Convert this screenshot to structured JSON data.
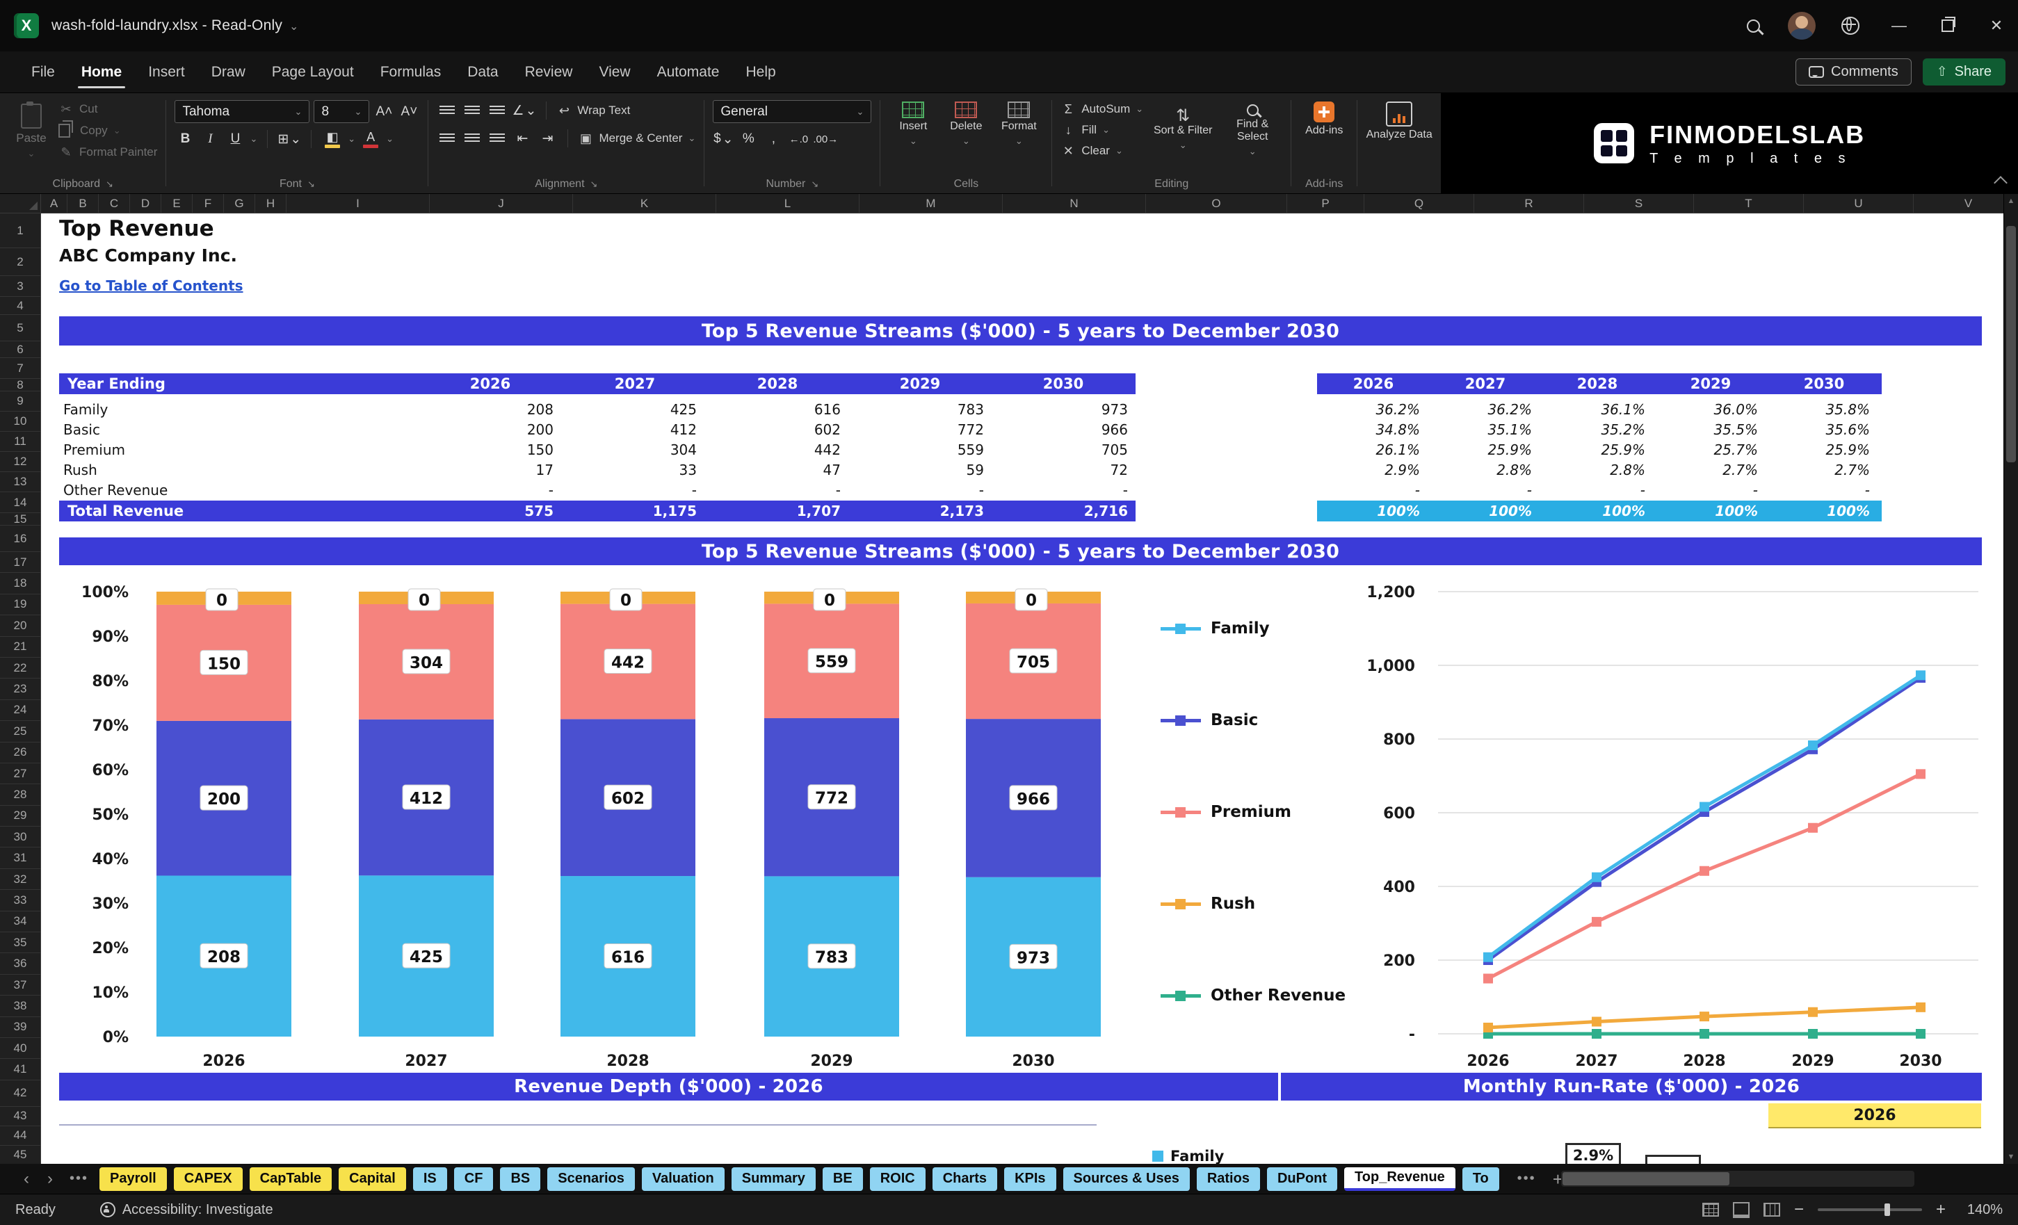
{
  "window": {
    "title": "wash-fold-laundry.xlsx  -  Read-Only"
  },
  "menu": {
    "items": [
      "File",
      "Home",
      "Insert",
      "Draw",
      "Page Layout",
      "Formulas",
      "Data",
      "Review",
      "View",
      "Automate",
      "Help"
    ],
    "active": "Home",
    "comments_label": "Comments",
    "share_label": "Share"
  },
  "ribbon": {
    "clipboard": {
      "label": "Clipboard",
      "paste": "Paste",
      "cut": "Cut",
      "copy": "Copy",
      "format_painter": "Format Painter"
    },
    "font": {
      "label": "Font",
      "name": "Tahoma",
      "size": "8"
    },
    "alignment": {
      "label": "Alignment",
      "wrap": "Wrap Text",
      "merge": "Merge & Center"
    },
    "number": {
      "label": "Number",
      "format": "General"
    },
    "cells": {
      "label": "Cells",
      "insert": "Insert",
      "delete": "Delete",
      "format": "Format"
    },
    "editing": {
      "label": "Editing",
      "autosum": "AutoSum",
      "fill": "Fill",
      "clear": "Clear",
      "sort_filter": "Sort & Filter",
      "find_select": "Find & Select"
    },
    "addins": {
      "label": "Add-ins",
      "button": "Add-ins",
      "analyze": "Analyze Data"
    },
    "brand": {
      "line1": "FINMODELSLAB",
      "line2": "T e m p l a t e s"
    }
  },
  "grid": {
    "columns": [
      "A",
      "B",
      "C",
      "D",
      "E",
      "F",
      "G",
      "H",
      "I",
      "J",
      "K",
      "L",
      "M",
      "N",
      "O",
      "P",
      "Q",
      "R",
      "S",
      "T",
      "U",
      "V"
    ],
    "rows_start": 1,
    "rows_end": 45
  },
  "sheet": {
    "title": "Top Revenue",
    "company": "ABC Company Inc.",
    "toc": "Go to Table of Contents",
    "banner1": "Top 5 Revenue Streams ($'000) - 5 years to December 2030",
    "banner2": "Top 5 Revenue Streams ($'000) - 5 years to December 2030",
    "banner3": "Revenue Depth ($'000) - 2026",
    "banner4": "Monthly Run-Rate ($'000) - 2026",
    "year_cell": "2026",
    "runrate_value": "2.9%",
    "bottom_legend": "Family"
  },
  "table": {
    "header": "Year Ending",
    "years": [
      "2026",
      "2027",
      "2028",
      "2029",
      "2030"
    ],
    "rows": [
      {
        "label": "Family",
        "values": [
          "208",
          "425",
          "616",
          "783",
          "973"
        ],
        "pcts": [
          "36.2%",
          "36.2%",
          "36.1%",
          "36.0%",
          "35.8%"
        ]
      },
      {
        "label": "Basic",
        "values": [
          "200",
          "412",
          "602",
          "772",
          "966"
        ],
        "pcts": [
          "34.8%",
          "35.1%",
          "35.2%",
          "35.5%",
          "35.6%"
        ]
      },
      {
        "label": "Premium",
        "values": [
          "150",
          "304",
          "442",
          "559",
          "705"
        ],
        "pcts": [
          "26.1%",
          "25.9%",
          "25.9%",
          "25.7%",
          "25.9%"
        ]
      },
      {
        "label": "Rush",
        "values": [
          "17",
          "33",
          "47",
          "59",
          "72"
        ],
        "pcts": [
          "2.9%",
          "2.8%",
          "2.8%",
          "2.7%",
          "2.7%"
        ]
      },
      {
        "label": "Other Revenue",
        "values": [
          "-",
          "-",
          "-",
          "-",
          "-"
        ],
        "pcts": [
          "-",
          "-",
          "-",
          "-",
          "-"
        ]
      }
    ],
    "total": {
      "label": "Total Revenue",
      "values": [
        "575",
        "1,175",
        "1,707",
        "2,173",
        "2,716"
      ],
      "pcts": [
        "100%",
        "100%",
        "100%",
        "100%",
        "100%"
      ]
    }
  },
  "chart_data": [
    {
      "type": "bar",
      "subtype": "stacked-100",
      "title": "Top 5 Revenue Streams ($'000) - 5 years to December 2030",
      "categories": [
        "2026",
        "2027",
        "2028",
        "2029",
        "2030"
      ],
      "series": [
        {
          "name": "Family",
          "color": "#41B9EA",
          "values": [
            208,
            425,
            616,
            783,
            973
          ]
        },
        {
          "name": "Basic",
          "color": "#4A50D0",
          "values": [
            200,
            412,
            602,
            772,
            966
          ]
        },
        {
          "name": "Premium",
          "color": "#F5837E",
          "values": [
            150,
            304,
            442,
            559,
            705
          ]
        },
        {
          "name": "Rush",
          "color": "#F2A93C",
          "values": [
            17,
            33,
            47,
            59,
            72
          ]
        },
        {
          "name": "Other Revenue",
          "color": "#2FAF8C",
          "values": [
            0,
            0,
            0,
            0,
            0
          ]
        }
      ],
      "y_ticks": [
        "100%",
        "90%",
        "80%",
        "70%",
        "60%",
        "50%",
        "40%",
        "30%",
        "20%",
        "10%",
        "0%"
      ],
      "legend_position": "right",
      "grid": false
    },
    {
      "type": "line",
      "x": [
        "2026",
        "2027",
        "2028",
        "2029",
        "2030"
      ],
      "series": [
        {
          "name": "Family",
          "color": "#41B9EA",
          "values": [
            208,
            425,
            616,
            783,
            973
          ]
        },
        {
          "name": "Basic",
          "color": "#4A50D0",
          "values": [
            200,
            412,
            602,
            772,
            966
          ]
        },
        {
          "name": "Premium",
          "color": "#F5837E",
          "values": [
            150,
            304,
            442,
            559,
            705
          ]
        },
        {
          "name": "Rush",
          "color": "#F2A93C",
          "values": [
            17,
            33,
            47,
            59,
            72
          ]
        },
        {
          "name": "Other Revenue",
          "color": "#2FAF8C",
          "values": [
            0,
            0,
            0,
            0,
            0
          ]
        }
      ],
      "ylim": [
        0,
        1200
      ],
      "y_ticks": [
        "1,200",
        "1,000",
        "800",
        "600",
        "400",
        "200",
        "-"
      ],
      "grid": true
    }
  ],
  "tabs": {
    "active": "Top_Revenue",
    "items": [
      {
        "label": "Payroll",
        "color": "yellow"
      },
      {
        "label": "CAPEX",
        "color": "yellow"
      },
      {
        "label": "CapTable",
        "color": "yellow"
      },
      {
        "label": "Capital",
        "color": "yellow"
      },
      {
        "label": "IS",
        "color": "blue"
      },
      {
        "label": "CF",
        "color": "blue"
      },
      {
        "label": "BS",
        "color": "blue"
      },
      {
        "label": "Scenarios",
        "color": "blue"
      },
      {
        "label": "Valuation",
        "color": "blue"
      },
      {
        "label": "Summary",
        "color": "blue"
      },
      {
        "label": "BE",
        "color": "blue"
      },
      {
        "label": "ROIC",
        "color": "blue"
      },
      {
        "label": "Charts",
        "color": "blue"
      },
      {
        "label": "KPIs",
        "color": "blue"
      },
      {
        "label": "Sources & Uses",
        "color": "blue"
      },
      {
        "label": "Ratios",
        "color": "blue"
      },
      {
        "label": "DuPont",
        "color": "blue"
      },
      {
        "label": "Top_Revenue",
        "color": "active"
      },
      {
        "label": "To",
        "color": "blue",
        "partial": true
      }
    ]
  },
  "statusbar": {
    "ready": "Ready",
    "accessibility": "Accessibility: Investigate",
    "zoom": "140%"
  },
  "colors": {
    "banner_blue": "#3B3BD8",
    "total_cyan": "#29ADE3",
    "tab_yellow": "#F7E14B",
    "tab_blue": "#90D4F2",
    "highlight_yellow": "#FFE96A"
  }
}
